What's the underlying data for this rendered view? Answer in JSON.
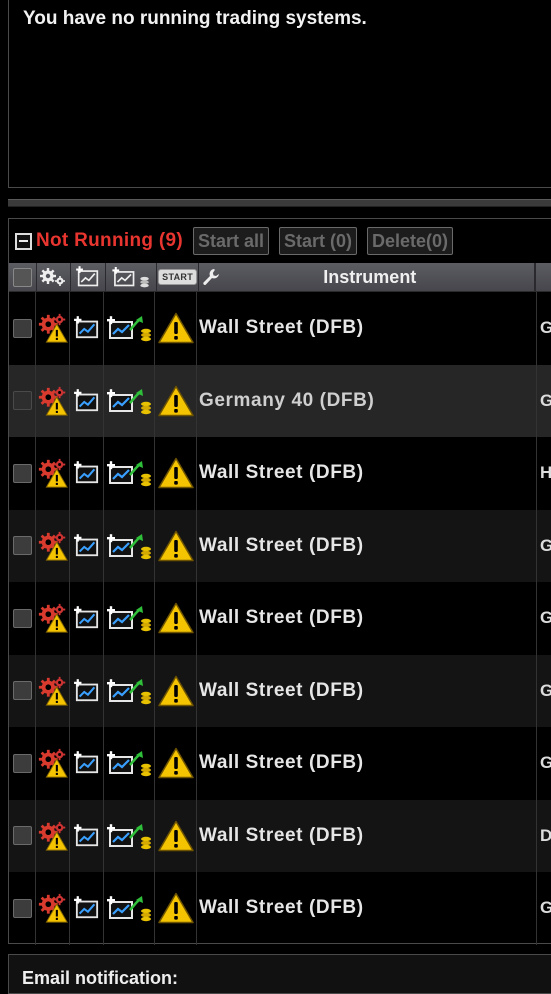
{
  "running": {
    "message": "You have no running trading systems."
  },
  "not_running": {
    "title": "Not Running (9)",
    "buttons": {
      "start_all": "Start all",
      "start": "Start (0)",
      "delete": "Delete(0)"
    },
    "columns": {
      "start_icon_label": "START",
      "instrument": "Instrument"
    },
    "rows": [
      {
        "instrument": "Wall Street (DFB)",
        "next_col": "G"
      },
      {
        "instrument": "Germany 40 (DFB)",
        "next_col": "G"
      },
      {
        "instrument": "Wall Street (DFB)",
        "next_col": "H"
      },
      {
        "instrument": "Wall Street (DFB)",
        "next_col": "G"
      },
      {
        "instrument": "Wall Street (DFB)",
        "next_col": "G"
      },
      {
        "instrument": "Wall Street (DFB)",
        "next_col": "G"
      },
      {
        "instrument": "Wall Street (DFB)",
        "next_col": "G"
      },
      {
        "instrument": "Wall Street (DFB)",
        "next_col": "D"
      },
      {
        "instrument": "Wall Street (DFB)",
        "next_col": "G"
      }
    ]
  },
  "email": {
    "label": "Email notification:"
  },
  "colors": {
    "accent_red": "#e8352f",
    "warning_yellow": "#f5c400",
    "header_gray": "#52525a"
  }
}
